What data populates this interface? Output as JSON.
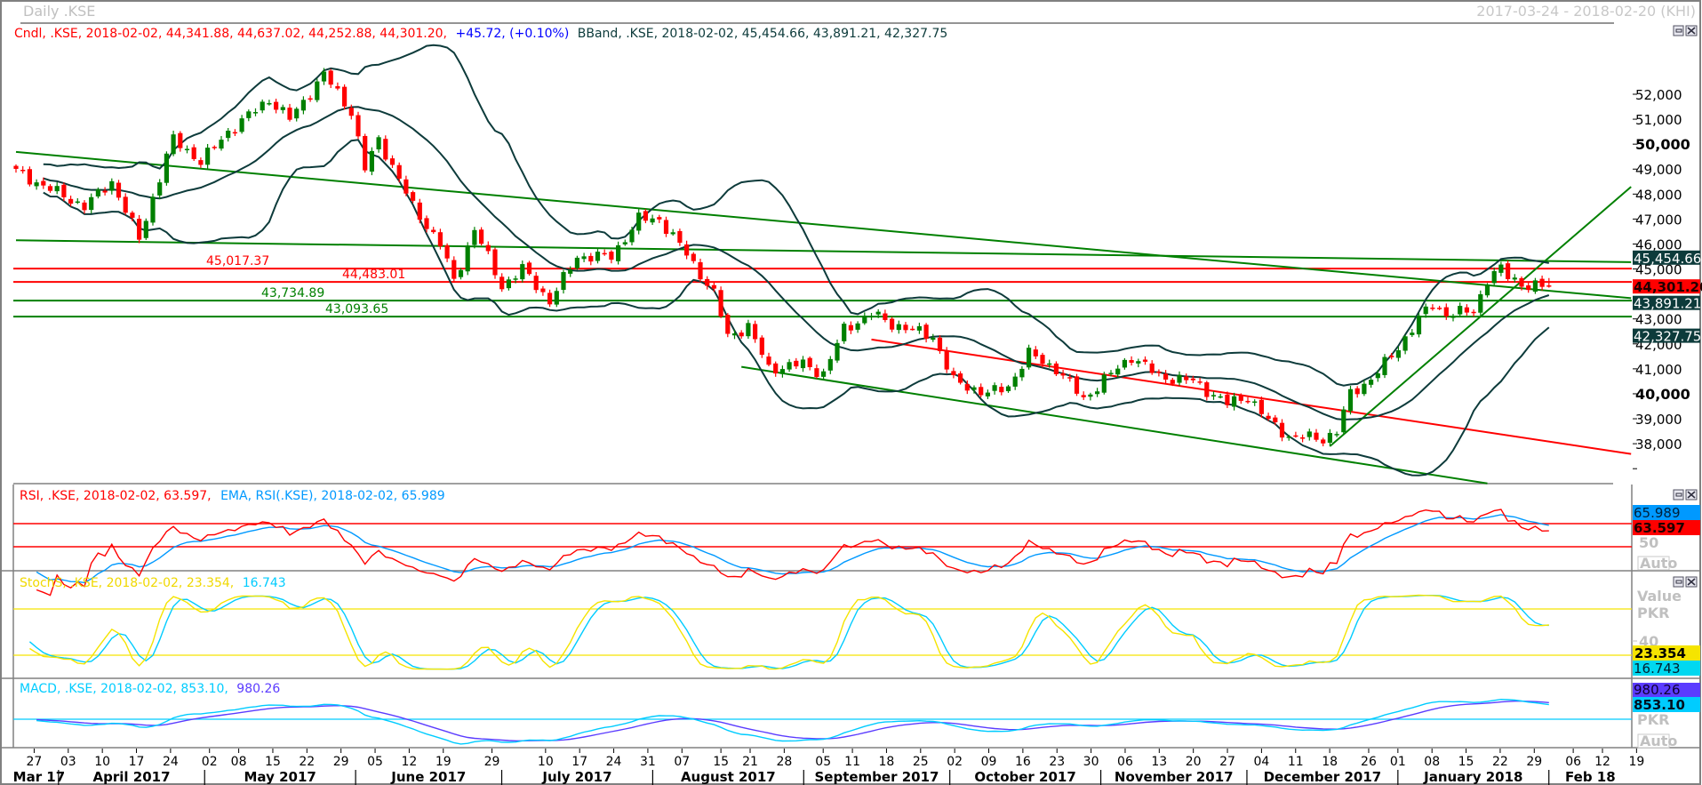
{
  "window": {
    "title": "Daily .KSE",
    "range": "2017-03-24 - 2018-02-20 (KHI)"
  },
  "legend": {
    "cndl": "Cndl, .KSE, 2018-02-02, 44,341.88, 44,637.02, 44,252.88, 44,301.20,",
    "change": "+45.72, (+0.10%)",
    "bband": "BBand, .KSE, 2018-02-02, 45,454.66, 43,891.21, 42,327.75"
  },
  "price_labels": {
    "upper": "45,454.66",
    "last": "44,301.20",
    "middle": "43,891.21",
    "lower": "42,327.75"
  },
  "rsi": {
    "legend_rsi": "RSI, .KSE, 2018-02-02, 63.597,",
    "legend_ema": "EMA, RSI(.KSE), 2018-02-02, 65.989",
    "ema_value": "65.989",
    "rsi_value": "63.597",
    "axis_label": "50",
    "auto": "Auto"
  },
  "stoch": {
    "legend_k": "StochS, .KSE, 2018-02-02, 23.354,",
    "legend_d": "16.743",
    "value_label": "Value",
    "unit": "PKR",
    "axis_label": "40",
    "k_value": "23.354",
    "d_value": "16.743"
  },
  "macd": {
    "legend_macd": "MACD, .KSE, 2018-02-02, 853.10,",
    "legend_signal": "980.26",
    "signal_value": "980.26",
    "macd_value": "853.10",
    "unit": "PKR",
    "auto": "Auto"
  },
  "colors": {
    "up": "#008000",
    "down": "#ff0000",
    "band": "#0d3b3b",
    "rsi": "#ff0000",
    "rsi_ema": "#0099ff",
    "stoch_k": "#f5e400",
    "stoch_d": "#00ccff",
    "macd": "#00ccff",
    "signal": "#5b3cff"
  },
  "chart_data": {
    "type": "candlestick",
    "title": "Daily .KSE",
    "start_date": "2017-03-24",
    "end_date": "2018-02-02",
    "trading_days": 225,
    "ylim": [
      36500,
      53500
    ],
    "price_ticks": [
      {
        "v": 52000,
        "label": "52,000"
      },
      {
        "v": 51000,
        "label": "51,000"
      },
      {
        "v": 50000,
        "label": "50,000",
        "bold": true
      },
      {
        "v": 49000,
        "label": "49,000"
      },
      {
        "v": 48000,
        "label": "48,000"
      },
      {
        "v": 47000,
        "label": "47,000"
      },
      {
        "v": 46000,
        "label": "46,000"
      },
      {
        "v": 45000,
        "label": "45,000"
      },
      {
        "v": 43000,
        "label": "43,000"
      },
      {
        "v": 42000,
        "label": "42,000"
      },
      {
        "v": 41000,
        "label": "41,000"
      },
      {
        "v": 40000,
        "label": "40,000",
        "bold": true
      },
      {
        "v": 39000,
        "label": "39,000"
      },
      {
        "v": 38000,
        "label": "38,000"
      },
      {
        "v": 37000,
        "label": ""
      }
    ],
    "close_keypoints": [
      [
        0,
        48900
      ],
      [
        10,
        47500
      ],
      [
        14,
        48500
      ],
      [
        18,
        46200
      ],
      [
        22,
        49500
      ],
      [
        23,
        50200
      ],
      [
        27,
        49300
      ],
      [
        31,
        50500
      ],
      [
        37,
        51800
      ],
      [
        40,
        51000
      ],
      [
        45,
        52800
      ],
      [
        49,
        51300
      ],
      [
        51,
        49000
      ],
      [
        53,
        50200
      ],
      [
        58,
        47500
      ],
      [
        62,
        46000
      ],
      [
        64,
        44500
      ],
      [
        67,
        46600
      ],
      [
        71,
        44300
      ],
      [
        74,
        45000
      ],
      [
        78,
        43700
      ],
      [
        82,
        45500
      ],
      [
        87,
        45500
      ],
      [
        91,
        47000
      ],
      [
        94,
        47000
      ],
      [
        98,
        45600
      ],
      [
        102,
        44000
      ],
      [
        104,
        42300
      ],
      [
        107,
        42700
      ],
      [
        110,
        41000
      ],
      [
        115,
        41200
      ],
      [
        118,
        40800
      ],
      [
        121,
        42600
      ],
      [
        125,
        43200
      ],
      [
        128,
        42800
      ],
      [
        134,
        42300
      ],
      [
        137,
        40500
      ],
      [
        142,
        40000
      ],
      [
        145,
        40300
      ],
      [
        148,
        41600
      ],
      [
        152,
        41000
      ],
      [
        156,
        39800
      ],
      [
        160,
        40800
      ],
      [
        163,
        41500
      ],
      [
        167,
        40700
      ],
      [
        172,
        40500
      ],
      [
        177,
        39600
      ],
      [
        180,
        39900
      ],
      [
        183,
        38900
      ],
      [
        186,
        38300
      ],
      [
        191,
        38200
      ],
      [
        193,
        38500
      ],
      [
        195,
        40000
      ],
      [
        198,
        40600
      ],
      [
        201,
        41500
      ],
      [
        205,
        43000
      ],
      [
        207,
        43600
      ],
      [
        209,
        43200
      ],
      [
        213,
        43300
      ],
      [
        215,
        44600
      ],
      [
        217,
        45000
      ],
      [
        218,
        44700
      ],
      [
        221,
        44300
      ],
      [
        224,
        44301.2
      ]
    ],
    "last_candle": {
      "date": "2018-02-02",
      "open": 44341.88,
      "high": 44637.02,
      "low": 44252.88,
      "close": 44301.2,
      "change": 45.72,
      "change_pct": 0.1
    },
    "bollinger": {
      "period": 20,
      "stdev": 2,
      "upper": 45454.66,
      "middle": 43891.21,
      "lower": 42327.75
    },
    "levels": [
      {
        "value": 45017.37,
        "label": "45,017.37",
        "color": "#ff0000"
      },
      {
        "value": 44483.01,
        "label": "44,483.01",
        "color": "#ff0000"
      },
      {
        "value": 43734.89,
        "label": "43,734.89",
        "color": "#008000"
      },
      {
        "value": 43093.65,
        "label": "43,093.65",
        "color": "#008000"
      }
    ],
    "trendlines": [
      {
        "from": [
          0,
          49690
        ],
        "to": [
          236,
          43830
        ],
        "color": "#008000"
      },
      {
        "from": [
          0,
          46150
        ],
        "to": [
          236,
          45275
        ],
        "color": "#008000"
      },
      {
        "from": [
          106,
          41080
        ],
        "to": [
          215,
          36410
        ],
        "color": "#008000"
      },
      {
        "from": [
          125,
          42175
        ],
        "to": [
          236,
          37590
        ],
        "color": "#ff0000"
      },
      {
        "from": [
          192,
          37900
        ],
        "to": [
          236,
          48290
        ],
        "color": "#008000"
      }
    ],
    "indicators": {
      "rsi": {
        "period": 14,
        "value": 63.597,
        "ema": 65.989,
        "levels": [
          70,
          50
        ]
      },
      "stoch": {
        "k": 23.354,
        "d": 16.743,
        "levels": [
          80,
          20
        ]
      },
      "macd": {
        "macd": 853.1,
        "signal": 980.26
      }
    },
    "x_ticks": [
      {
        "date": "2017-03-27",
        "label": "27"
      },
      {
        "date": "2017-04-03",
        "label": "03"
      },
      {
        "date": "2017-04-10",
        "label": "10"
      },
      {
        "date": "2017-04-17",
        "label": "17"
      },
      {
        "date": "2017-04-24",
        "label": "24"
      },
      {
        "date": "2017-05-02",
        "label": "02"
      },
      {
        "date": "2017-05-08",
        "label": "08"
      },
      {
        "date": "2017-05-15",
        "label": "15"
      },
      {
        "date": "2017-05-22",
        "label": "22"
      },
      {
        "date": "2017-05-29",
        "label": "29"
      },
      {
        "date": "2017-06-05",
        "label": "05"
      },
      {
        "date": "2017-06-12",
        "label": "12"
      },
      {
        "date": "2017-06-19",
        "label": "19"
      },
      {
        "date": "2017-06-29",
        "label": "29"
      },
      {
        "date": "2017-07-10",
        "label": "10"
      },
      {
        "date": "2017-07-17",
        "label": "17"
      },
      {
        "date": "2017-07-24",
        "label": "24"
      },
      {
        "date": "2017-07-31",
        "label": "31"
      },
      {
        "date": "2017-08-07",
        "label": "07"
      },
      {
        "date": "2017-08-15",
        "label": "15"
      },
      {
        "date": "2017-08-21",
        "label": "21"
      },
      {
        "date": "2017-08-28",
        "label": "28"
      },
      {
        "date": "2017-09-05",
        "label": "05"
      },
      {
        "date": "2017-09-11",
        "label": "11"
      },
      {
        "date": "2017-09-18",
        "label": "18"
      },
      {
        "date": "2017-09-25",
        "label": "25"
      },
      {
        "date": "2017-10-02",
        "label": "02"
      },
      {
        "date": "2017-10-09",
        "label": "09"
      },
      {
        "date": "2017-10-16",
        "label": "16"
      },
      {
        "date": "2017-10-23",
        "label": "23"
      },
      {
        "date": "2017-10-30",
        "label": "30"
      },
      {
        "date": "2017-11-06",
        "label": "06"
      },
      {
        "date": "2017-11-13",
        "label": "13"
      },
      {
        "date": "2017-11-20",
        "label": "20"
      },
      {
        "date": "2017-11-27",
        "label": "27"
      },
      {
        "date": "2017-12-04",
        "label": "04"
      },
      {
        "date": "2017-12-11",
        "label": "11"
      },
      {
        "date": "2017-12-18",
        "label": "18"
      },
      {
        "date": "2017-12-26",
        "label": "26"
      },
      {
        "date": "2018-01-01",
        "label": "01"
      },
      {
        "date": "2018-01-08",
        "label": "08"
      },
      {
        "date": "2018-01-15",
        "label": "15"
      },
      {
        "date": "2018-01-22",
        "label": "22"
      },
      {
        "date": "2018-01-29",
        "label": "29"
      },
      {
        "date": "2018-02-06",
        "label": "06"
      },
      {
        "date": "2018-02-12",
        "label": "12"
      },
      {
        "date": "2018-02-19",
        "label": "19"
      }
    ],
    "months": [
      {
        "start": "2017-03-24",
        "end": "2017-04-01",
        "label": "Mar 17"
      },
      {
        "start": "2017-04-01",
        "end": "2017-05-01",
        "label": "April 2017"
      },
      {
        "start": "2017-05-01",
        "end": "2017-06-01",
        "label": "May 2017"
      },
      {
        "start": "2017-06-01",
        "end": "2017-07-01",
        "label": "June 2017"
      },
      {
        "start": "2017-07-01",
        "end": "2017-08-01",
        "label": "July 2017"
      },
      {
        "start": "2017-08-01",
        "end": "2017-09-01",
        "label": "August 2017"
      },
      {
        "start": "2017-09-01",
        "end": "2017-10-01",
        "label": "September 2017"
      },
      {
        "start": "2017-10-01",
        "end": "2017-11-01",
        "label": "October 2017"
      },
      {
        "start": "2017-11-01",
        "end": "2017-12-01",
        "label": "November 2017"
      },
      {
        "start": "2017-12-01",
        "end": "2018-01-01",
        "label": "December 2017"
      },
      {
        "start": "2018-01-01",
        "end": "2018-02-01",
        "label": "January 2018"
      },
      {
        "start": "2018-02-01",
        "end": "2018-02-23",
        "label": "Feb 18"
      }
    ]
  }
}
